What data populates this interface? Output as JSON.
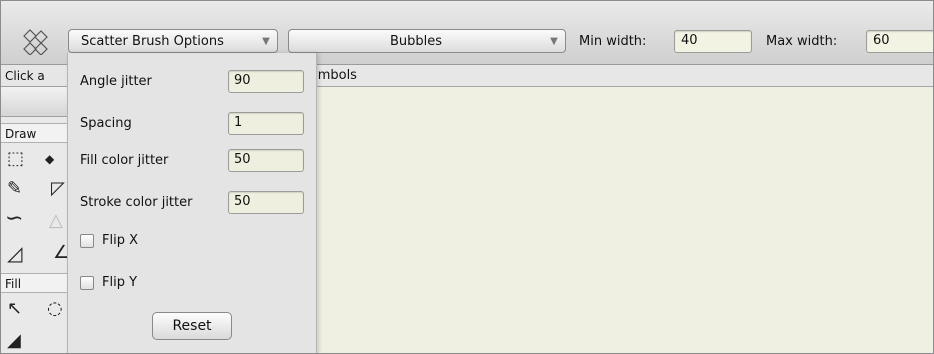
{
  "toolbar": {
    "brush_dropdown": {
      "label": "Scatter Brush Options",
      "arrow": "▼"
    },
    "shape_dropdown": {
      "label": "Bubbles",
      "arrow": "▼"
    },
    "min_width": {
      "label": "Min width:",
      "value": "40"
    },
    "max_width": {
      "label": "Max width:",
      "value": "60"
    }
  },
  "sidebar": {
    "click_label": "Click a",
    "draw_section": "Draw",
    "fill_section": "Fill"
  },
  "symbols_tab": {
    "label": "ymbols"
  },
  "popup": {
    "angle_jitter": {
      "label": "Angle jitter",
      "value": "90"
    },
    "spacing": {
      "label": "Spacing",
      "value": "1"
    },
    "fill_color_jitter": {
      "label": "Fill color jitter",
      "value": "50"
    },
    "stroke_color_jitter": {
      "label": "Stroke color jitter",
      "value": "50"
    },
    "flip_x": {
      "label": "Flip X",
      "checked": false
    },
    "flip_y": {
      "label": "Flip Y",
      "checked": false
    },
    "reset_label": "Reset"
  },
  "colors": {
    "canvas": "#efefe2",
    "field": "#efefdf",
    "toolbar": "#d8d8d8"
  }
}
